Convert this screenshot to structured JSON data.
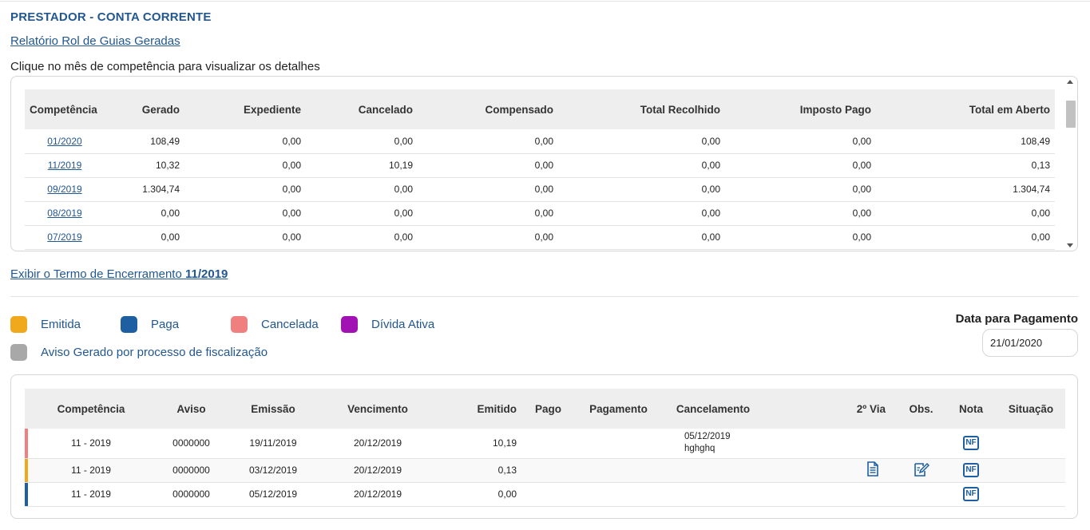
{
  "header": {
    "title": "PRESTADOR - CONTA CORRENTE",
    "report_link": "Relatório Rol de Guias Geradas",
    "hint": "Clique no mês de competência para visualizar os detalhes"
  },
  "summary_table": {
    "columns": [
      "Competência",
      "Gerado",
      "Expediente",
      "Cancelado",
      "Compensado",
      "Total Recolhido",
      "Imposto Pago",
      "Total em Aberto"
    ],
    "rows": [
      {
        "competencia": "01/2020",
        "gerado": "108,49",
        "expediente": "0,00",
        "cancelado": "0,00",
        "compensado": "0,00",
        "total_recolhido": "0,00",
        "imposto_pago": "0,00",
        "total_aberto": "108,49"
      },
      {
        "competencia": "11/2019",
        "gerado": "10,32",
        "expediente": "0,00",
        "cancelado": "10,19",
        "compensado": "0,00",
        "total_recolhido": "0,00",
        "imposto_pago": "0,00",
        "total_aberto": "0,13"
      },
      {
        "competencia": "09/2019",
        "gerado": "1.304,74",
        "expediente": "0,00",
        "cancelado": "0,00",
        "compensado": "0,00",
        "total_recolhido": "0,00",
        "imposto_pago": "0,00",
        "total_aberto": "1.304,74"
      },
      {
        "competencia": "08/2019",
        "gerado": "0,00",
        "expediente": "0,00",
        "cancelado": "0,00",
        "compensado": "0,00",
        "total_recolhido": "0,00",
        "imposto_pago": "0,00",
        "total_aberto": "0,00"
      },
      {
        "competencia": "07/2019",
        "gerado": "0,00",
        "expediente": "0,00",
        "cancelado": "0,00",
        "compensado": "0,00",
        "total_recolhido": "0,00",
        "imposto_pago": "0,00",
        "total_aberto": "0,00"
      }
    ]
  },
  "term_link": {
    "text": "Exibir o Termo de Encerramento ",
    "period": "11/2019"
  },
  "legend": [
    {
      "label": "Emitida",
      "color": "#f0a81c"
    },
    {
      "label": "Paga",
      "color": "#1d5fa0"
    },
    {
      "label": "Cancelada",
      "color": "#f08080"
    },
    {
      "label": "Dívida Ativa",
      "color": "#a211b3"
    },
    {
      "label": "Aviso Gerado por processo de fiscalização",
      "color": "#a8a8a8"
    }
  ],
  "payment_date": {
    "label": "Data para Pagamento",
    "value": "21/01/2020"
  },
  "guides_table": {
    "columns": [
      "Competência",
      "Aviso",
      "Emissão",
      "Vencimento",
      "Emitido",
      "Pago",
      "Pagamento",
      "Cancelamento",
      "2º Via",
      "Obs.",
      "Nota",
      "Situação"
    ],
    "rows": [
      {
        "status_color": "#f08080",
        "competencia": "11 - 2019",
        "aviso": "0000000",
        "emissao": "19/11/2019",
        "vencimento": "20/12/2019",
        "emitido": "10,19",
        "pago": "",
        "pagamento": "",
        "cancelamento_date": "05/12/2019",
        "cancelamento_note": "hghghq",
        "has_second_copy": false,
        "has_obs": false,
        "nota_icon": "nf-icon",
        "nota_text": "NF",
        "situacao": ""
      },
      {
        "status_color": "#f0a81c",
        "competencia": "11 - 2019",
        "aviso": "0000000",
        "emissao": "03/12/2019",
        "vencimento": "20/12/2019",
        "emitido": "0,13",
        "pago": "",
        "pagamento": "",
        "cancelamento_date": "",
        "cancelamento_note": "",
        "has_second_copy": true,
        "second_copy_icon": "document-icon",
        "has_obs": true,
        "obs_icon": "edit-note-icon",
        "nota_icon": "nf-icon",
        "nota_text": "NF",
        "situacao": ""
      },
      {
        "status_color": "#1d5fa0",
        "competencia": "11 - 2019",
        "aviso": "0000000",
        "emissao": "05/12/2019",
        "vencimento": "20/12/2019",
        "emitido": "0,00",
        "pago": "",
        "pagamento": "",
        "cancelamento_date": "",
        "cancelamento_note": "",
        "has_second_copy": false,
        "has_obs": false,
        "nota_icon": "nf-icon",
        "nota_text": "NF",
        "situacao": ""
      }
    ]
  }
}
